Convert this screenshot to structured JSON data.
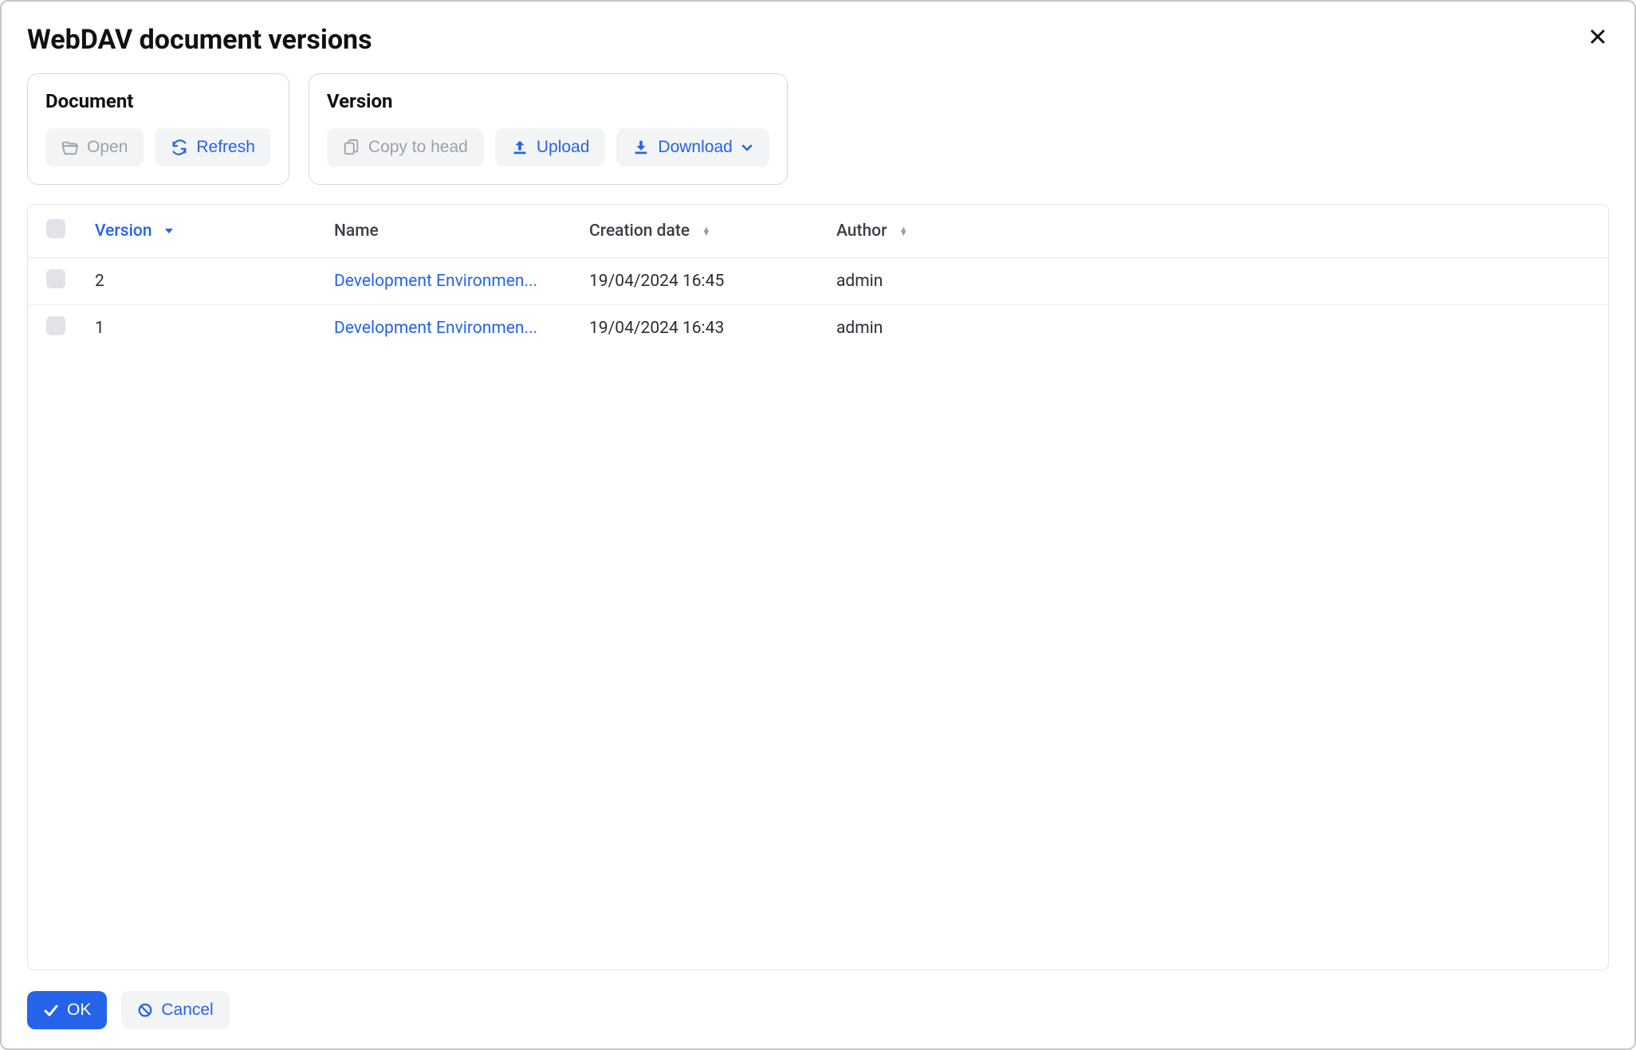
{
  "dialog": {
    "title": "WebDAV document versions"
  },
  "panels": {
    "document": {
      "title": "Document",
      "open_label": "Open",
      "refresh_label": "Refresh"
    },
    "version": {
      "title": "Version",
      "copy_label": "Copy to head",
      "upload_label": "Upload",
      "download_label": "Download"
    }
  },
  "table": {
    "headers": {
      "version": "Version",
      "name": "Name",
      "creation_date": "Creation date",
      "author": "Author"
    },
    "rows": [
      {
        "version": "2",
        "name": "Development Environmen...",
        "creation_date": "19/04/2024 16:45",
        "author": "admin"
      },
      {
        "version": "1",
        "name": "Development Environmen...",
        "creation_date": "19/04/2024 16:43",
        "author": "admin"
      }
    ]
  },
  "footer": {
    "ok_label": "OK",
    "cancel_label": "Cancel"
  }
}
